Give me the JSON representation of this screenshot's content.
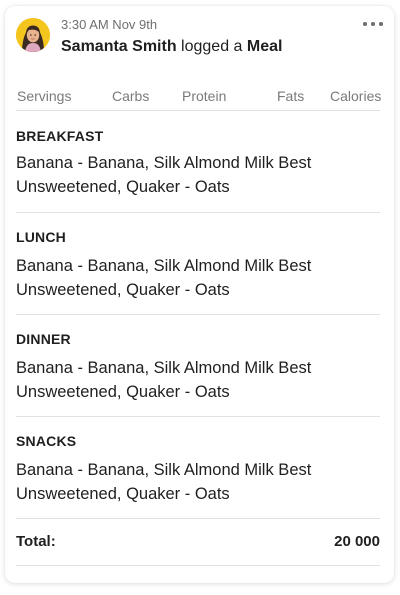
{
  "post": {
    "timestamp": "3:30 AM Nov 9th",
    "user_name": "Samanta Smith",
    "action_text": "logged a",
    "object_text": "Meal",
    "menu_icon": "more-horizontal-icon",
    "avatar_bg": "#f4c51d"
  },
  "columns": [
    "Servings",
    "Carbs",
    "Protein",
    "Fats",
    "Calories"
  ],
  "meals": [
    {
      "title": "BREAKFAST",
      "items": "Banana - Banana, Silk Almond Milk Best Unsweetened, Quaker - Oats"
    },
    {
      "title": "LUNCH",
      "items": "Banana - Banana, Silk Almond Milk Best Unsweetened, Quaker - Oats"
    },
    {
      "title": "DINNER",
      "items": "Banana - Banana, Silk Almond Milk Best Unsweetened, Quaker - Oats"
    },
    {
      "title": "SNACKS",
      "items": "Banana - Banana, Silk Almond Milk Best Unsweetened, Quaker - Oats"
    }
  ],
  "total": {
    "label": "Total:",
    "value": "20 000"
  }
}
